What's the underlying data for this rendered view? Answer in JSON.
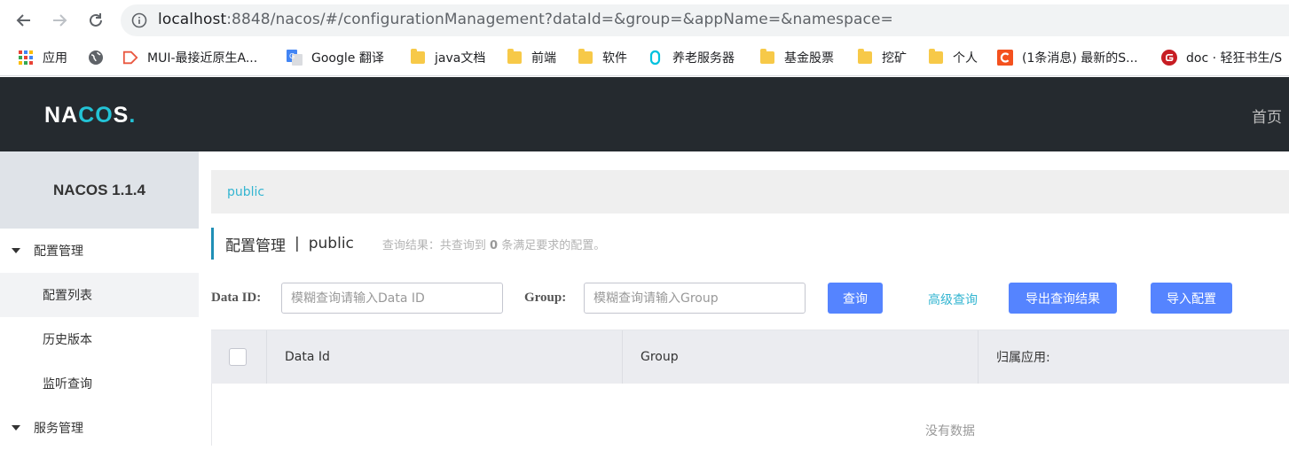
{
  "browser": {
    "url_host": "localhost",
    "url_rest": ":8848/nacos/#/configurationManagement?dataId=&group=&appName=&namespace=",
    "bookmarks": [
      {
        "label": "应用",
        "icon": "apps-grid-icon"
      },
      {
        "label": "",
        "icon": "globe-icon"
      },
      {
        "label": "MUI-最接近原生A...",
        "icon": "mui-icon"
      },
      {
        "label": "Google 翻译",
        "icon": "google-translate-icon"
      },
      {
        "label": "java文档",
        "icon": "folder-icon"
      },
      {
        "label": "前端",
        "icon": "folder-icon"
      },
      {
        "label": "软件",
        "icon": "folder-icon"
      },
      {
        "label": "养老服务器",
        "icon": "aliyun-icon"
      },
      {
        "label": "基金股票",
        "icon": "folder-icon"
      },
      {
        "label": "挖矿",
        "icon": "folder-icon"
      },
      {
        "label": "个人",
        "icon": "folder-icon"
      },
      {
        "label": "(1条消息) 最新的S...",
        "icon": "csdn-icon"
      },
      {
        "label": "doc · 轻狂书生/S",
        "icon": "gitee-icon"
      }
    ]
  },
  "header": {
    "logo_text": "NACOS.",
    "home_label": "首页"
  },
  "sidebar": {
    "title": "NACOS 1.1.4",
    "groups": [
      {
        "label": "配置管理"
      },
      {
        "label": "服务管理"
      }
    ],
    "items": [
      {
        "label": "配置列表"
      },
      {
        "label": "历史版本"
      },
      {
        "label": "监听查询"
      }
    ]
  },
  "main": {
    "namespace_link": "public",
    "title": "配置管理",
    "title_sep": "|",
    "title_ns": "public",
    "result_prefix": "查询结果：共查询到",
    "result_count": "0",
    "result_suffix": "条满足要求的配置。",
    "filters": {
      "data_id_label": "Data ID:",
      "data_id_placeholder": "模糊查询请输入Data ID",
      "data_id_value": "",
      "group_label": "Group:",
      "group_placeholder": "模糊查询请输入Group",
      "group_value": ""
    },
    "buttons": {
      "search": "查询",
      "advanced": "高级查询",
      "export": "导出查询结果",
      "import": "导入配置"
    },
    "table": {
      "columns": [
        "Data Id",
        "Group",
        "归属应用:"
      ],
      "empty_text": "没有数据"
    }
  },
  "colors": {
    "header_bg": "#252a2f",
    "primary": "#5584ff",
    "link": "#33b5d1",
    "logo_accent": "#23c3d6"
  }
}
